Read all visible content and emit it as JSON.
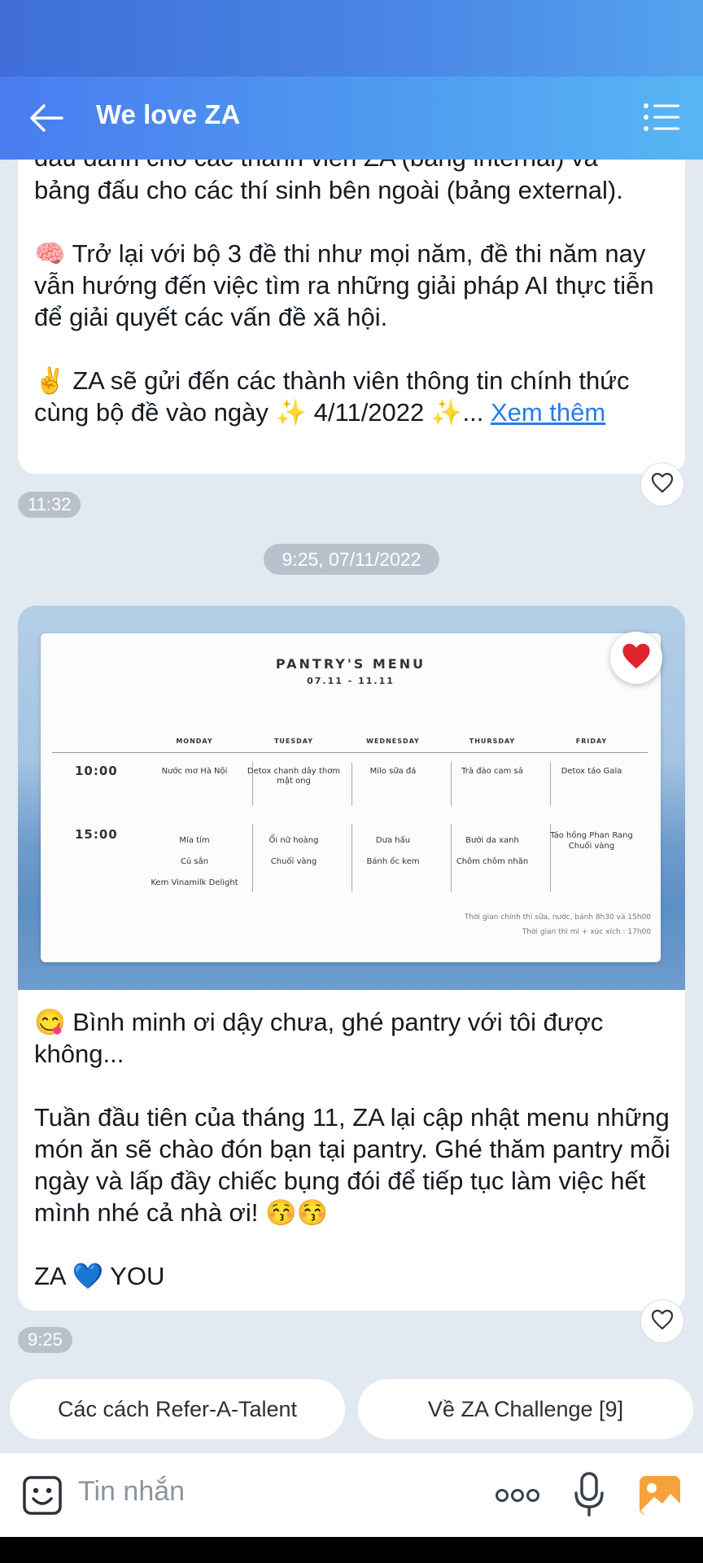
{
  "header": {
    "title": "We love ZA",
    "back_icon": "back-arrow-icon",
    "menu_icon": "list-menu-icon"
  },
  "message1": {
    "clipped_line": "dấu dành cho các thành viên ZA (bảng internal) và",
    "body": "bảng đấu cho các thí sinh bên ngoài (bảng external).\n\n🧠 Trở lại với bộ 3 đề thi như mọi năm, đề thi năm nay vẫn hướng đến việc tìm ra những giải pháp AI thực tiễn để giải quyết các vấn đề xã hội.\n\n✌️ ZA sẽ gửi đến các thành viên thông tin chính thức cùng bộ đề vào ngày ✨ 4/11/2022 ✨...",
    "see_more": "Xem thêm",
    "time": "11:32"
  },
  "date_separator": "9:25, 07/11/2022",
  "message2": {
    "image": {
      "title": "PANTRY'S MENU",
      "date_range": "07.11 - 11.11",
      "days": [
        "MONDAY",
        "TUESDAY",
        "WEDNESDAY",
        "THURSDAY",
        "FRIDAY"
      ],
      "slots": [
        {
          "time": "10:00",
          "items": [
            "Nước mơ Hà Nội",
            "Detox chanh dây thơm mật ong",
            "Milo sữa đá",
            "Trà đào cam sả",
            "Detox táo Gala"
          ]
        },
        {
          "time": "15:00",
          "items": [
            "Mía tím\nCủ sắn\nKem Vinamilk Delight",
            "Ổi nữ hoàng\nChuối vàng",
            "Dưa hấu\nBánh ốc kem",
            "Bưởi da xanh\nChôm chôm nhãn",
            "Táo hồng Phan Rang\nChuối vàng"
          ]
        }
      ],
      "note1": "Thời gian chính thì sữa, nước, bánh 8h30 và 15h00",
      "note2": "Thời gian thì mì + xúc xích : 17h00",
      "reaction_icon": "red-heart-icon"
    },
    "body": "😋 Bình minh ơi dậy chưa, ghé pantry với tôi được không...\n\nTuần đầu tiên của tháng 11, ZA lại cập nhật menu những món ăn sẽ chào đón bạn tại pantry. Ghé thăm pantry mỗi ngày và lấp đầy chiếc bụng đói để tiếp tục làm việc hết mình nhé cả nhà ơi! 😚😚\n\nZA 💙 YOU",
    "time": "9:25"
  },
  "quick_replies": [
    "Các cách Refer-A-Talent",
    "Về ZA Challenge [9]"
  ],
  "composer": {
    "placeholder": "Tin nhắn",
    "icons": [
      "sticker-icon",
      "more-dots-icon",
      "microphone-icon",
      "image-icon"
    ]
  },
  "colors": {
    "header_start": "#4a7cf0",
    "header_end": "#58b6f3",
    "chat_background": "#e2e9f1",
    "link": "#2b7be6",
    "time_pill": "#b8c1cb",
    "image_icon": "#f5a23a"
  }
}
